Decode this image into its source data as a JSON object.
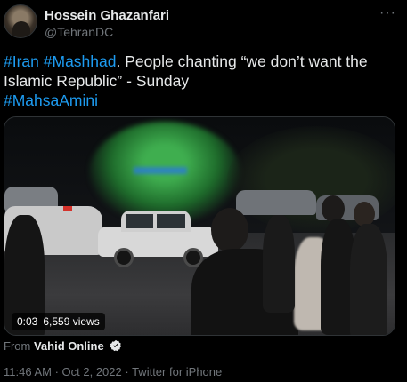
{
  "author": {
    "name": "Hossein Ghazanfari",
    "handle": "@TehranDC"
  },
  "more_label": "···",
  "tweet": {
    "hashtag_1": "#Iran",
    "hashtag_2": "#Mashhad",
    "text": ". People chanting “we don’t want the Islamic Republic” - Sunday",
    "hashtag_3": "#MahsaAmini"
  },
  "media": {
    "time": "0:03",
    "views": "6,559 views"
  },
  "source": {
    "prefix": "From",
    "name": "Vahid Online",
    "verified_icon": "verified-badge-icon"
  },
  "meta": {
    "time": "11:46 AM",
    "separator_1": " · ",
    "date": "Oct 2, 2022",
    "separator_2": " · ",
    "client": "Twitter for iPhone"
  },
  "colors": {
    "background": "#000000",
    "text": "#e7e9ea",
    "secondary": "#71767b",
    "link": "#1d9bf0"
  }
}
